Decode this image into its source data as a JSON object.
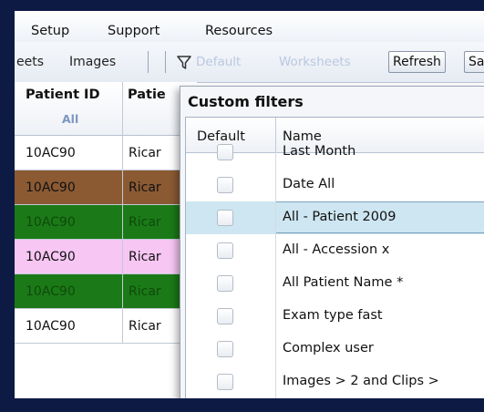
{
  "menu": [
    "Setup",
    "Support",
    "Resources"
  ],
  "toolbar": {
    "worksheets_tab": "eets",
    "images_tab": "Images",
    "filter_default": "Default",
    "filter_worksheets": "Worksheets",
    "refresh_label": "Refresh",
    "next_label": "Sa"
  },
  "grid": {
    "col_patient_id": "Patient ID",
    "col_patient_name": "Patie",
    "filter_all": "All",
    "rows": [
      {
        "id": "10AC90",
        "name": "Ricar",
        "bg": "#ffffff",
        "fg": "#111111"
      },
      {
        "id": "10AC90",
        "name": "Ricar",
        "bg": "#8b5a33",
        "fg": "#111111"
      },
      {
        "id": "10AC90",
        "name": "Ricar",
        "bg": "#1b7a17",
        "fg": "#0e4a0c"
      },
      {
        "id": "10AC90",
        "name": "Ricar",
        "bg": "#f7c6f3",
        "fg": "#111111"
      },
      {
        "id": "10AC90",
        "name": "Ricar",
        "bg": "#1b7a17",
        "fg": "#0e4a0c"
      },
      {
        "id": "10AC90",
        "name": "Ricar",
        "bg": "#ffffff",
        "fg": "#111111"
      }
    ]
  },
  "popup": {
    "title": "Custom filters",
    "col_default": "Default",
    "col_name": "Name",
    "filters": [
      {
        "name": "Last Month"
      },
      {
        "name": "Date All"
      },
      {
        "name": "All - Patient 2009",
        "selected": true
      },
      {
        "name": "All - Accession x"
      },
      {
        "name": "All Patient Name *"
      },
      {
        "name": "Exam type fast"
      },
      {
        "name": "Complex user"
      },
      {
        "name": "Images > 2 and Clips >"
      }
    ]
  }
}
